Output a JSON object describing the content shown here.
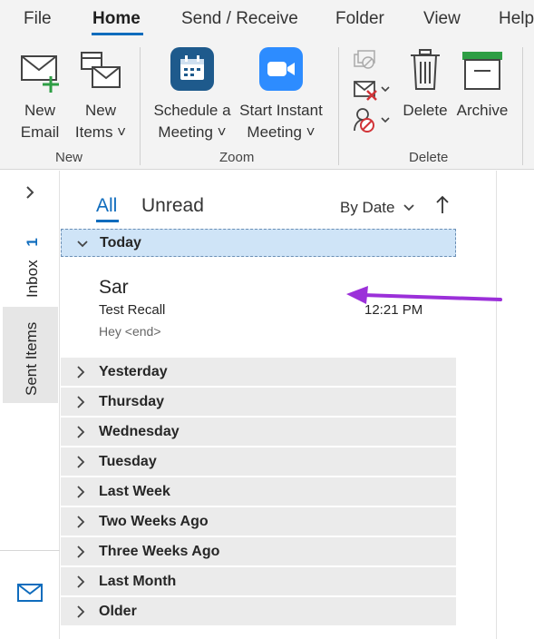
{
  "menu": {
    "tabs": [
      {
        "label": "File"
      },
      {
        "label": "Home"
      },
      {
        "label": "Send / Receive"
      },
      {
        "label": "Folder"
      },
      {
        "label": "View"
      },
      {
        "label": "Help"
      }
    ],
    "active_tab": "Home"
  },
  "ribbon": {
    "new_email": {
      "line1": "New",
      "line2": "Email",
      "icon": "new-email-icon"
    },
    "new_items": {
      "line1": "New",
      "line2": "Items ˅",
      "icon": "new-items-icon"
    },
    "group_new": "New",
    "schedule_meeting": {
      "line1": "Schedule a",
      "line2": "Meeting ˅",
      "icon": "calendar-icon"
    },
    "start_instant_meeting": {
      "line1": "Start Instant",
      "line2": "Meeting ˅",
      "icon": "video-camera-icon"
    },
    "group_zoom": "Zoom",
    "delete": {
      "label": "Delete",
      "icon": "trash-icon"
    },
    "archive": {
      "label": "Archive",
      "icon": "archive-icon"
    },
    "group_delete": "Delete",
    "colors": {
      "zoom_calendar": "#1e5a8c",
      "zoom_camera": "#2d8cff",
      "new_plus": "#2e9e44",
      "archive_green": "#2e9e44",
      "accent": "#0f6cbd"
    }
  },
  "folders": {
    "inbox_label": "Inbox",
    "inbox_count": "1",
    "sent_label": "Sent Items"
  },
  "list": {
    "tab_all": "All",
    "tab_unread": "Unread",
    "sort_label": "By Date",
    "groups": [
      {
        "label": "Today",
        "expanded": true
      },
      {
        "label": "Yesterday"
      },
      {
        "label": "Thursday"
      },
      {
        "label": "Wednesday"
      },
      {
        "label": "Tuesday"
      },
      {
        "label": "Last Week"
      },
      {
        "label": "Two Weeks Ago"
      },
      {
        "label": "Three Weeks Ago"
      },
      {
        "label": "Last Month"
      },
      {
        "label": "Older"
      }
    ],
    "message": {
      "sender": "Sar",
      "subject": "Test Recall",
      "time": "12:21 PM",
      "preview": "Hey <end>"
    }
  },
  "annotation_color": "#9b30d9"
}
